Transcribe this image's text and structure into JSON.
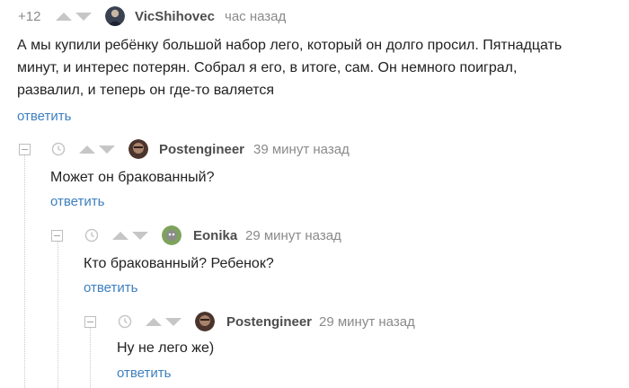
{
  "comments": [
    {
      "rating": "+12",
      "author": "VicShihovec",
      "time": "час назад",
      "text_lines": [
        "А мы купили ребёнку большой набор лего, который он долго просил. Пятнадцать",
        "минут, и интерес потерян. Собрал я его, в итоге, сам. Он немного поиграл,",
        "развалил, и теперь он где-то валяется"
      ],
      "reply_label": "ответить",
      "avatar_color": "#2b3140"
    },
    {
      "author": "Postengineer",
      "time": "39 минут назад",
      "text_lines": [
        "Может он бракованный?"
      ],
      "reply_label": "ответить",
      "avatar_color": "#5a3f35"
    },
    {
      "author": "Eonika",
      "time": "29 минут назад",
      "text_lines": [
        "Кто бракованный? Ребенок?"
      ],
      "reply_label": "ответить",
      "avatar_color": "#6b8f4e"
    },
    {
      "author": "Postengineer",
      "time": "29 минут назад",
      "text_lines": [
        "Ну не лего же)"
      ],
      "reply_label": "ответить",
      "avatar_color": "#5a3f35"
    }
  ],
  "colors": {
    "link": "#3d7fbf",
    "muted": "#8a8a8a",
    "author": "#4d4d4d",
    "vote_arrow": "#c6c6c6"
  },
  "icons": {
    "collapse": "minus-square-icon",
    "clock": "clock-icon",
    "vote_up": "arrow-up-icon",
    "vote_down": "arrow-down-icon"
  }
}
